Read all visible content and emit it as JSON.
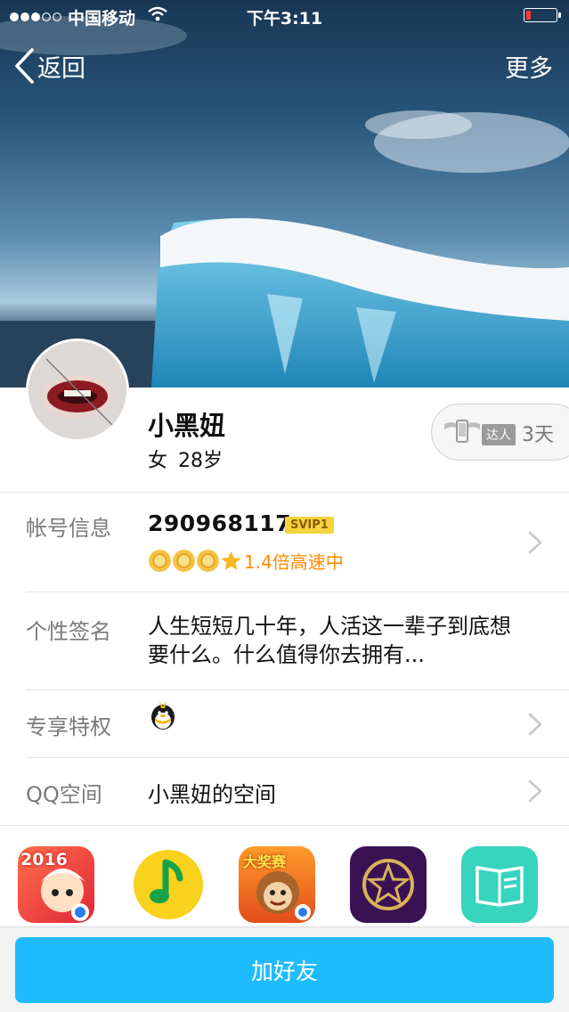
{
  "status_bar": {
    "carrier": "中国移动",
    "time": "下午3:11",
    "signal_bars": 3,
    "battery_level": 0.15
  },
  "nav": {
    "back_label": "返回",
    "more_label": "更多"
  },
  "profile": {
    "name": "小黑妞",
    "gender": "女",
    "age": "28岁",
    "talent_badge": "达人",
    "talent_days": "3天"
  },
  "account": {
    "label": "帐号信息",
    "qq_number": "290968117",
    "vip_badge": "SVIP1",
    "level_icons": [
      "sun-icon",
      "sun-icon",
      "sun-icon",
      "star-icon"
    ],
    "speed_text": "1.4倍高速中"
  },
  "signature": {
    "label": "个性签名",
    "text": "人生短短几十年，人活这一辈子到底想要什么。什么值得你去拥有..."
  },
  "privilege": {
    "label": "专享特权",
    "icon": "qq-penguin-icon"
  },
  "qzone": {
    "label": "QQ空间",
    "value": "小黑妞的空间"
  },
  "apps": [
    {
      "name": "game-2016-app-icon",
      "badge": "2016"
    },
    {
      "name": "qq-music-app-icon"
    },
    {
      "name": "lottery-game-app-icon",
      "badge": "大奖赛"
    },
    {
      "name": "star-app-icon"
    },
    {
      "name": "book-reader-app-icon"
    }
  ],
  "actions": {
    "add_friend_label": "加好友"
  },
  "colors": {
    "accent": "#1EBCFF",
    "speed_orange": "#FF8A00",
    "svip_gold": "#F5D33F"
  }
}
